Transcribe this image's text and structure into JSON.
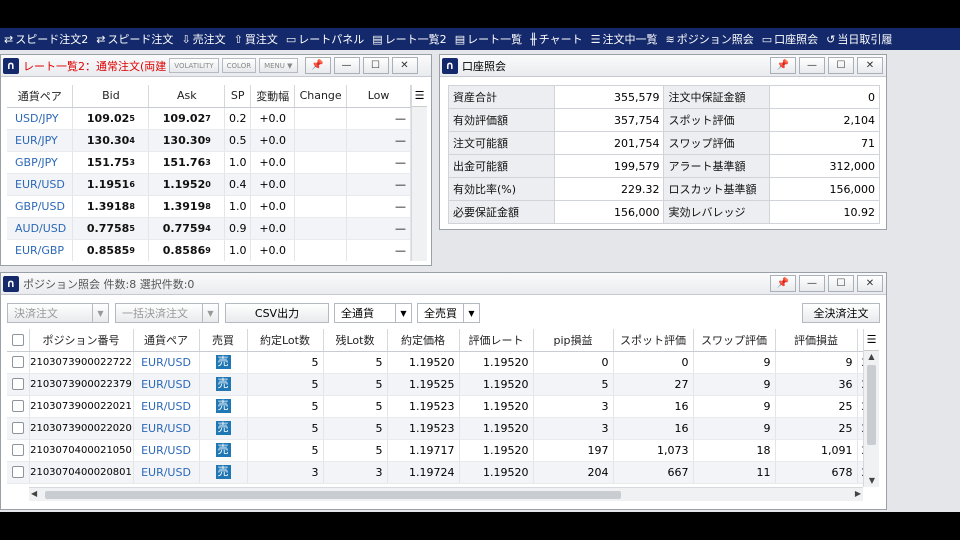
{
  "toolbar": [
    {
      "icon": "speed-order-icon",
      "glyph": "⇄",
      "label": "スピード注文2"
    },
    {
      "icon": "speed-order-icon",
      "glyph": "⇄",
      "label": "スピード注文"
    },
    {
      "icon": "sell-order-icon",
      "glyph": "⇩",
      "label": "売注文"
    },
    {
      "icon": "buy-order-icon",
      "glyph": "⇧",
      "label": "買注文"
    },
    {
      "icon": "rate-panel-icon",
      "glyph": "▭",
      "label": "レートパネル"
    },
    {
      "icon": "rate-list2-icon",
      "glyph": "▤",
      "label": "レート一覧2"
    },
    {
      "icon": "rate-list-icon",
      "glyph": "▤",
      "label": "レート一覧"
    },
    {
      "icon": "chart-icon",
      "glyph": "╫",
      "label": "チャート"
    },
    {
      "icon": "order-list-icon",
      "glyph": "☰",
      "label": "注文中一覧"
    },
    {
      "icon": "position-icon",
      "glyph": "≋",
      "label": "ポジション照会"
    },
    {
      "icon": "account-icon",
      "glyph": "▭",
      "label": "口座照会"
    },
    {
      "icon": "today-trade-icon",
      "glyph": "↺",
      "label": "当日取引履"
    }
  ],
  "rate_window": {
    "title": "レート一覧2：通常注文(両建",
    "buttons": [
      "VOLATILITY",
      "COLOR",
      "MENU ▼"
    ],
    "columns": [
      "通貨ペア",
      "Bid",
      "Ask",
      "SP",
      "変動幅",
      "Change",
      "Low"
    ],
    "rows": [
      {
        "pair": "USD/JPY",
        "bid_main": "109.02",
        "bid_sub": "5",
        "ask_main": "109.02",
        "ask_sub": "7",
        "sp": "0.2",
        "chg": "+0.0",
        "low": "—"
      },
      {
        "pair": "EUR/JPY",
        "bid_main": "130.30",
        "bid_sub": "4",
        "ask_main": "130.30",
        "ask_sub": "9",
        "sp": "0.5",
        "chg": "+0.0",
        "low": "—"
      },
      {
        "pair": "GBP/JPY",
        "bid_main": "151.75",
        "bid_sub": "3",
        "ask_main": "151.76",
        "ask_sub": "3",
        "sp": "1.0",
        "chg": "+0.0",
        "low": "—"
      },
      {
        "pair": "EUR/USD",
        "bid_main": "1.1951",
        "bid_sub": "6",
        "ask_main": "1.1952",
        "ask_sub": "0",
        "sp": "0.4",
        "chg": "+0.0",
        "low": "—"
      },
      {
        "pair": "GBP/USD",
        "bid_main": "1.3918",
        "bid_sub": "8",
        "ask_main": "1.3919",
        "ask_sub": "8",
        "sp": "1.0",
        "chg": "+0.0",
        "low": "—"
      },
      {
        "pair": "AUD/USD",
        "bid_main": "0.7758",
        "bid_sub": "5",
        "ask_main": "0.7759",
        "ask_sub": "4",
        "sp": "0.9",
        "chg": "+0.0",
        "low": "—"
      },
      {
        "pair": "EUR/GBP",
        "bid_main": "0.8585",
        "bid_sub": "9",
        "ask_main": "0.8586",
        "ask_sub": "9",
        "sp": "1.0",
        "chg": "+0.0",
        "low": "—"
      }
    ]
  },
  "account_window": {
    "title": "口座照会",
    "rows": [
      {
        "l1": "資産合計",
        "v1": "355,579",
        "l2": "注文中保証金額",
        "v2": "0"
      },
      {
        "l1": "有効評価額",
        "v1": "357,754",
        "l2": "スポット評価",
        "v2": "2,104"
      },
      {
        "l1": "注文可能額",
        "v1": "201,754",
        "l2": "スワップ評価",
        "v2": "71"
      },
      {
        "l1": "出金可能額",
        "v1": "199,579",
        "l2": "アラート基準額",
        "v2": "312,000"
      },
      {
        "l1": "有効比率(%)",
        "v1": "229.32",
        "l2": "ロスカット基準額",
        "v2": "156,000"
      },
      {
        "l1": "必要保証金額",
        "v1": "156,000",
        "l2": "実効レバレッジ",
        "v2": "10.92"
      }
    ]
  },
  "position_window": {
    "title": "ポジション照会 件数:8 選択件数:0",
    "settle_order": "決済注文",
    "bulk_settle": "一括決済注文",
    "csv": "CSV出力",
    "currency_filter": "全通貨",
    "side_filter": "全売買",
    "settle_all": "全決済注文",
    "columns": [
      "ポジション番号",
      "通貨ペア",
      "売買",
      "約定Lot数",
      "残Lot数",
      "約定価格",
      "評価レート",
      "pip損益",
      "スポット評価",
      "スワップ評価",
      "評価損益"
    ],
    "rows": [
      {
        "id": "2103073900022722",
        "pair": "EUR/USD",
        "side": "売",
        "lot": "5",
        "rem": "5",
        "price": "1.19520",
        "rate": "1.19520",
        "pip": "0",
        "spot": "0",
        "swap": "9",
        "pl": "9",
        "extra": "2"
      },
      {
        "id": "2103073900022379",
        "pair": "EUR/USD",
        "side": "売",
        "lot": "5",
        "rem": "5",
        "price": "1.19525",
        "rate": "1.19520",
        "pip": "5",
        "spot": "27",
        "swap": "9",
        "pl": "36",
        "extra": "2"
      },
      {
        "id": "2103073900022021",
        "pair": "EUR/USD",
        "side": "売",
        "lot": "5",
        "rem": "5",
        "price": "1.19523",
        "rate": "1.19520",
        "pip": "3",
        "spot": "16",
        "swap": "9",
        "pl": "25",
        "extra": "2"
      },
      {
        "id": "2103073900022020",
        "pair": "EUR/USD",
        "side": "売",
        "lot": "5",
        "rem": "5",
        "price": "1.19523",
        "rate": "1.19520",
        "pip": "3",
        "spot": "16",
        "swap": "9",
        "pl": "25",
        "extra": "2"
      },
      {
        "id": "2103070400021050",
        "pair": "EUR/USD",
        "side": "売",
        "lot": "5",
        "rem": "5",
        "price": "1.19717",
        "rate": "1.19520",
        "pip": "197",
        "spot": "1,073",
        "swap": "18",
        "pl": "1,091",
        "extra": "2"
      },
      {
        "id": "2103070400020801",
        "pair": "EUR/USD",
        "side": "売",
        "lot": "3",
        "rem": "3",
        "price": "1.19724",
        "rate": "1.19520",
        "pip": "204",
        "spot": "667",
        "swap": "11",
        "pl": "678",
        "extra": "2"
      }
    ]
  }
}
